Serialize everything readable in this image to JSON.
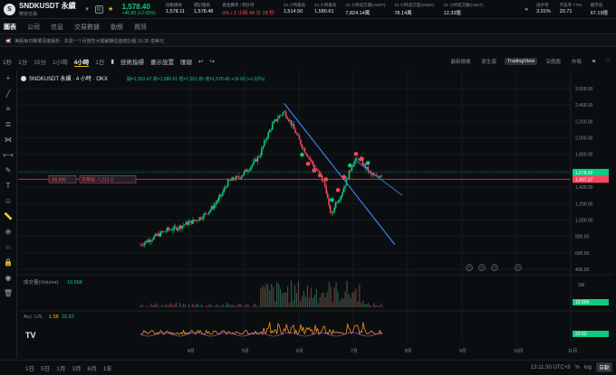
{
  "header": {
    "symbol": "SNDKUSDT 永續",
    "exchange": "幣安交易",
    "badge": "標",
    "price": "1,578.40",
    "change": "+40.80 (+2.65%)",
    "stats": [
      {
        "k": "指數價格",
        "v": "1,578.11",
        "cls": ""
      },
      {
        "k": "標記價格",
        "v": "1,578.48",
        "cls": ""
      },
      {
        "k": "資金費率 / 倒計時",
        "v": "0% / 2 小時 48 分 28 秒",
        "cls": "red"
      },
      {
        "k": "24 小時最低",
        "v": "1,514.50",
        "cls": ""
      },
      {
        "k": "24 小時最高",
        "v": "1,580.61",
        "cls": ""
      },
      {
        "k": "24 小時成交額(USDT)",
        "v": "7,824.14萬",
        "cls": ""
      },
      {
        "k": "24 小時成交量(SNDK)",
        "v": "78.14萬",
        "cls": ""
      },
      {
        "k": "24 小時成交額(USDT)",
        "v": "12.33億",
        "cls": ""
      }
    ],
    "right_stats": [
      {
        "k": "換手率",
        "v": "3.01%"
      },
      {
        "k": "市盈率 TTM",
        "v": "20.71"
      },
      {
        "k": "總市值",
        "v": "67.19億"
      }
    ]
  },
  "tabs": [
    "圖表",
    "公司",
    "信息",
    "交易數據",
    "動態",
    "資訊"
  ],
  "notice": "美股每日精選深度解析 · 本週一个月度性大額解鎖估值總計超 16.35 億美元",
  "toolbar": {
    "intervals": [
      "1秒",
      "1分",
      "15分",
      "1小時",
      "4小時",
      "1日"
    ],
    "active": "4小時",
    "tools": [
      "技術指標",
      "畫示設置",
      "匯總"
    ],
    "right_label": "最新價格",
    "views": [
      "原生版",
      "TradingView",
      "深度圖",
      "市場"
    ],
    "active_view": "TradingView"
  },
  "chart_data": {
    "type": "candlestick",
    "title": "SNDKUSDT 永續 · 4 小時 · OKX",
    "ohlc": "開=1,562.47 高=1,580.61 低=1,561.85 收=1,578.40 +18.00 (+1.02%)",
    "y_ticks": [
      "2,600.00",
      "2,400.00",
      "2,200.00",
      "2,000.00",
      "1,800.00",
      "1,600.00",
      "1,400.00",
      "1,200.00",
      "1,000.00",
      "800.00",
      "600.00",
      "400.00"
    ],
    "ylim": [
      400,
      2600
    ],
    "x_ticks": [
      "4月",
      "5月",
      "6月",
      "7月",
      "8月",
      "9月",
      "10月",
      "11月"
    ],
    "close_path": [
      [
        0,
        700
      ],
      [
        6,
        760
      ],
      [
        12,
        820
      ],
      [
        18,
        880
      ],
      [
        24,
        900
      ],
      [
        30,
        950
      ],
      [
        36,
        990
      ],
      [
        42,
        1050
      ],
      [
        48,
        1150
      ],
      [
        54,
        1300
      ],
      [
        58,
        1450
      ],
      [
        62,
        1500
      ],
      [
        66,
        1520
      ],
      [
        72,
        1620
      ],
      [
        76,
        1700
      ],
      [
        80,
        1800
      ],
      [
        84,
        2000
      ],
      [
        88,
        2150
      ],
      [
        92,
        2250
      ],
      [
        96,
        2320
      ],
      [
        100,
        2200
      ],
      [
        104,
        2050
      ],
      [
        108,
        1900
      ],
      [
        112,
        1780
      ],
      [
        116,
        1650
      ],
      [
        120,
        1550
      ],
      [
        124,
        1380
      ],
      [
        126,
        1150
      ],
      [
        128,
        1050
      ],
      [
        130,
        1200
      ],
      [
        134,
        1300
      ],
      [
        138,
        1500
      ],
      [
        142,
        1700
      ],
      [
        146,
        1750
      ],
      [
        150,
        1650
      ],
      [
        154,
        1550
      ],
      [
        158,
        1520
      ],
      [
        162,
        1578
      ]
    ],
    "x_max": 230,
    "price_tag": "1,578.40",
    "price_tag2": "1,497.37",
    "left_tag": "-88.888",
    "left_tag2": "夾擊線 -7,213.3",
    "volume_label": "成交量(Volume)",
    "volume_value": "16.56K",
    "volume_scale": "1M",
    "volume_tag": "16.56K",
    "acc_label": "Acc. L/S",
    "acc_v1": "1.58",
    "acc_v2": "22.62",
    "acc_tag": "22.62"
  },
  "bottom": {
    "ranges": [
      "1日",
      "5日",
      "1月",
      "3月",
      "6月",
      "1年"
    ],
    "time": "13:11:30 UTC+8",
    "right": [
      "%",
      "log",
      "自動"
    ]
  }
}
